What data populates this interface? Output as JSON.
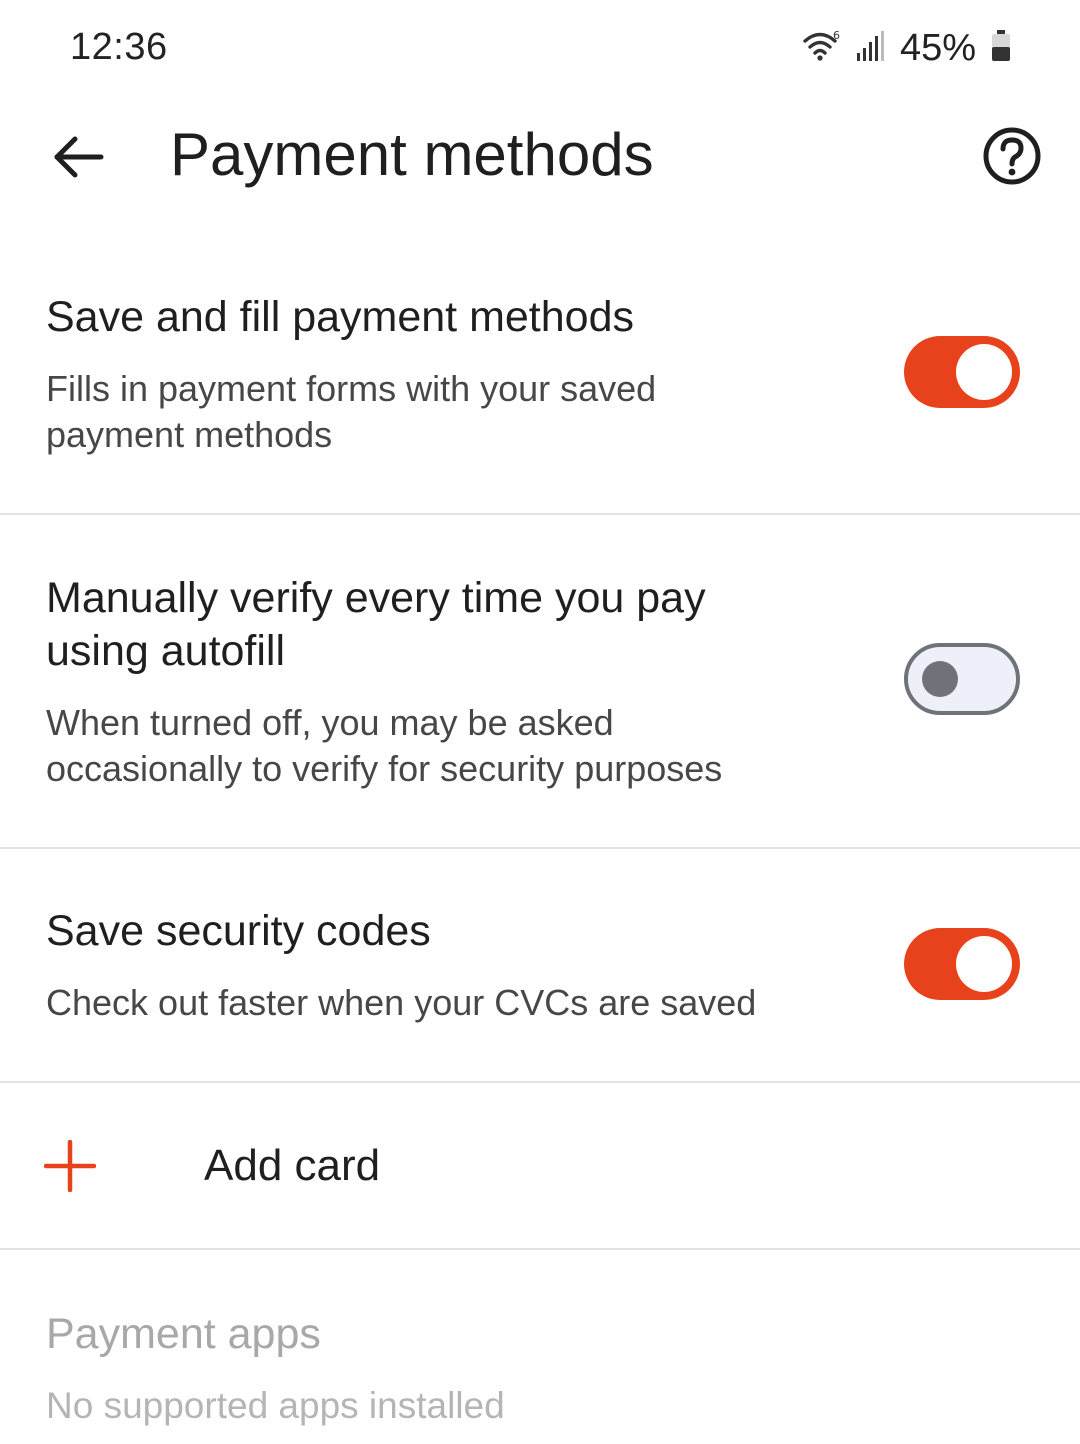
{
  "status_bar": {
    "time": "12:36",
    "battery_percent": "45%",
    "icons": [
      "wifi-icon",
      "signal-icon",
      "battery-icon"
    ]
  },
  "app_bar": {
    "title": "Payment methods",
    "back_icon": "back-arrow-icon",
    "help_icon": "help-icon"
  },
  "settings": {
    "save_fill": {
      "title": "Save and fill payment methods",
      "subtitle_line1": "Fills in payment forms with your saved",
      "subtitle_line2": "payment methods",
      "enabled": true
    },
    "manual_verify": {
      "title_line1": "Manually verify every time you pay",
      "title_line2": "using autofill",
      "subtitle_line1": "When turned off, you may be asked",
      "subtitle_line2": "occasionally to verify for security purposes",
      "enabled": false
    },
    "security_codes": {
      "title": "Save security codes",
      "subtitle": "Check out faster when your CVCs are saved",
      "enabled": true
    }
  },
  "add_card": {
    "label": "Add card",
    "icon": "plus-icon"
  },
  "payment_apps": {
    "title": "Payment apps",
    "subtitle": "No supported apps installed"
  },
  "colors": {
    "accent": "#e8421c",
    "switch_off_track": "#edf0f9",
    "switch_off_outline": "#6f7379",
    "divider": "#e3e3e3"
  }
}
